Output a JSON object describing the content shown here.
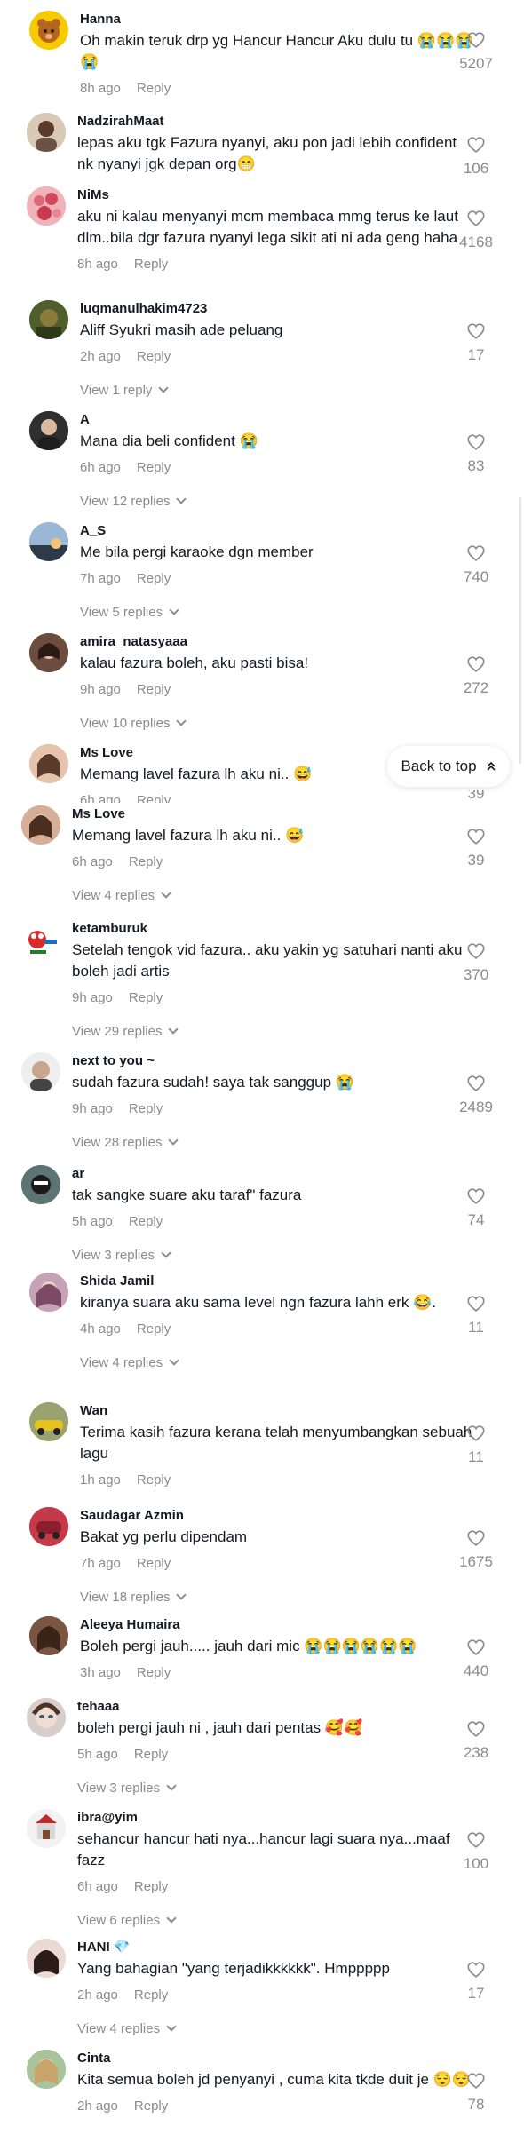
{
  "back_to_top": {
    "label": "Back to top",
    "icon": "double-chevron-up-icon"
  },
  "reply_label": "Reply",
  "comments": [
    {
      "username": "Hanna",
      "text": "Oh makin teruk drp yg Hancur Hancur Aku dulu tu 😭😭😭😭",
      "time": "8h ago",
      "likes": "5207",
      "view_replies": ""
    },
    {
      "username": "NadzirahMaat",
      "text": "lepas aku tgk Fazura nyanyi, aku pon jadi lebih confident nk nyanyi jgk depan org😁",
      "time": "",
      "likes": "106",
      "view_replies": ""
    },
    {
      "username": "NiMs",
      "text": "aku ni kalau menyanyi mcm membaca mmg terus ke laut dlm..bila dgr fazura nyanyi lega sikit ati ni ada geng haha",
      "time": "8h ago",
      "likes": "4168",
      "view_replies": ""
    },
    {
      "username": "luqmanulhakim4723",
      "text": "Aliff Syukri masih ade peluang",
      "time": "2h ago",
      "likes": "17",
      "view_replies": "View 1 reply"
    },
    {
      "username": "A",
      "text": "Mana dia beli confident 😭",
      "time": "6h ago",
      "likes": "83",
      "view_replies": "View 12 replies"
    },
    {
      "username": "A_S",
      "text": "Me bila pergi karaoke dgn member",
      "time": "7h ago",
      "likes": "740",
      "view_replies": "View 5 replies"
    },
    {
      "username": "amira_natasyaaa",
      "text": "kalau fazura boleh, aku pasti bisa!",
      "time": "9h ago",
      "likes": "272",
      "view_replies": "View 10 replies"
    },
    {
      "username": "Ms Love",
      "text": "Memang lavel fazura lh aku ni.. 😅",
      "time": "6h ago",
      "likes": "39",
      "view_replies": ""
    },
    {
      "username": "Ms Love",
      "text": "Memang lavel fazura lh aku ni.. 😅",
      "time": "6h ago",
      "likes": "39",
      "view_replies": "View 4 replies"
    },
    {
      "username": "ketamburuk",
      "text": "Setelah tengok vid fazura.. aku yakin yg satuhari nanti aku boleh jadi artis",
      "time": "9h ago",
      "likes": "370",
      "view_replies": "View 29 replies"
    },
    {
      "username": "next to you ~",
      "text": "sudah fazura sudah! saya tak sanggup 😭",
      "time": "9h ago",
      "likes": "2489",
      "view_replies": "View 28 replies"
    },
    {
      "username": "ar",
      "text": "tak sangke suare aku taraf\" fazura",
      "time": "5h ago",
      "likes": "74",
      "view_replies": "View 3 replies"
    },
    {
      "username": "Shida Jamil",
      "text": "kiranya suara aku sama level ngn fazura lahh erk 😂.",
      "time": "4h ago",
      "likes": "11",
      "view_replies": "View 4 replies"
    },
    {
      "username": "Wan",
      "text": "Terima kasih fazura kerana telah menyumbangkan sebuah lagu",
      "time": "1h ago",
      "likes": "11",
      "view_replies": ""
    },
    {
      "username": "Saudagar Azmin",
      "text": "Bakat yg perlu dipendam",
      "time": "7h ago",
      "likes": "1675",
      "view_replies": "View 18 replies"
    },
    {
      "username": "Aleeya Humaira",
      "text": "Boleh pergi jauh..... jauh dari mic 😭😭😭😭😭😭",
      "time": "3h ago",
      "likes": "440",
      "view_replies": ""
    },
    {
      "username": "tehaaa",
      "text": "boleh pergi jauh ni , jauh dari pentas 🥰🥰",
      "time": "5h ago",
      "likes": "238",
      "view_replies": "View 3 replies"
    },
    {
      "username": "ibra@yim",
      "text": "sehancur hancur hati nya...hancur lagi suara nya...maaf fazz",
      "time": "6h ago",
      "likes": "100",
      "view_replies": "View 6 replies"
    },
    {
      "username": "HANI 💎",
      "text": "Yang bahagian \"yang terjadikkkkkk\". Hmppppp",
      "time": "2h ago",
      "likes": "17",
      "view_replies": "View 4 replies"
    },
    {
      "username": "Cinta",
      "text": "Kita semua boleh jd penyanyi , cuma kita tkde duit je 😌😌",
      "time": "2h ago",
      "likes": "78",
      "view_replies": ""
    }
  ]
}
